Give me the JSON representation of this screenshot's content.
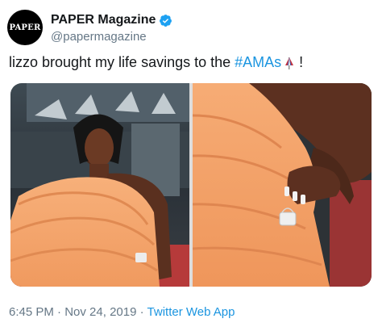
{
  "user": {
    "avatar_text": "PAPER",
    "display_name": "PAPER Magazine",
    "handle": "@papermagazine",
    "verified_icon": "verified-badge-icon"
  },
  "tweet": {
    "text": "lizzo brought my life savings to the",
    "hashtag": "#AMAs",
    "emoji": "flag-emoji",
    "trailing": "!"
  },
  "footer": {
    "time": "6:45 PM",
    "sep1": "·",
    "date": "Nov 24, 2019",
    "sep2": "·",
    "source": "Twitter Web App"
  },
  "colors": {
    "link": "#1b95e0",
    "muted": "#657786",
    "text": "#14171a",
    "dress": "#f4a46c"
  }
}
